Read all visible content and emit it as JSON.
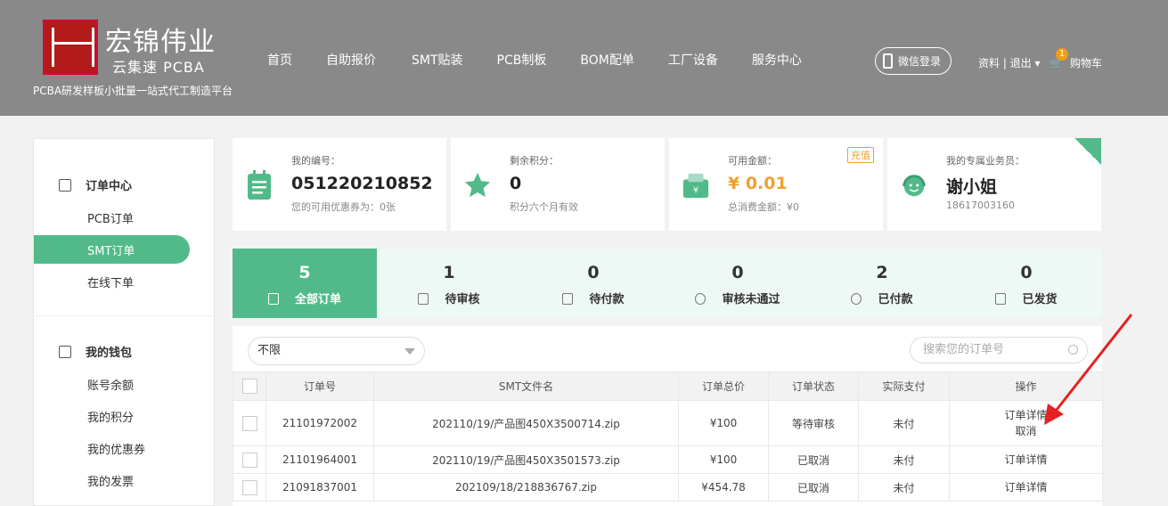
{
  "header": {
    "logo_title": "宏锦伟业",
    "logo_sub": "云集速 PCBA",
    "tagline": "PCBA研发样板小批量一站式代工制造平台",
    "nav": [
      "首页",
      "自助报价",
      "SMT贴装",
      "PCB制板",
      "BOM配单",
      "工厂设备",
      "服务中心"
    ],
    "wechat_login": "微信登录",
    "user_links": "资料 | 退出 ▾",
    "cart_label": "购物车",
    "cart_count": "1"
  },
  "sidebar": {
    "order_center": "订单中心",
    "order_items": [
      "PCB订单",
      "SMT订单",
      "在线下单"
    ],
    "active_item": "SMT订单",
    "wallet": "我的钱包",
    "wallet_items": [
      "账号余额",
      "我的积分",
      "我的优惠券",
      "我的发票"
    ]
  },
  "cards": {
    "id": {
      "label": "我的编号：",
      "value": "051220210852",
      "note": "您的可用优惠券为：0张"
    },
    "points": {
      "label": "剩余积分：",
      "value": "0",
      "note": "积分六个月有效"
    },
    "balance": {
      "label": "可用金额：",
      "value": "¥ 0.01",
      "note": "总消费金额：¥0",
      "badge": "充值"
    },
    "rep": {
      "label": "我的专属业务员：",
      "value": "谢小姐",
      "note": "18617003160"
    }
  },
  "tabs": [
    {
      "count": "5",
      "label": "全部订单"
    },
    {
      "count": "1",
      "label": "待审核"
    },
    {
      "count": "0",
      "label": "待付款"
    },
    {
      "count": "0",
      "label": "审核未通过"
    },
    {
      "count": "2",
      "label": "已付款"
    },
    {
      "count": "0",
      "label": "已发货"
    }
  ],
  "filter": {
    "value": "不限",
    "search_placeholder": "搜索您的订单号"
  },
  "table": {
    "headers": [
      "订单号",
      "SMT文件名",
      "订单总价",
      "订单状态",
      "实际支付",
      "操作"
    ],
    "rows": [
      {
        "id": "21101972002",
        "file": "202110/19/产品图450X3500714.zip",
        "price": "¥100",
        "status": "等待审核",
        "paid": "未付",
        "action1": "订单详情",
        "action2": "取消"
      },
      {
        "id": "21101964001",
        "file": "202110/19/产品图450X3501573.zip",
        "price": "¥100",
        "status": "已取消",
        "paid": "未付",
        "action1": "订单详情",
        "action2": ""
      },
      {
        "id": "21091837001",
        "file": "202109/18/218836767.zip",
        "price": "¥454.78",
        "status": "已取消",
        "paid": "未付",
        "action1": "订单详情",
        "action2": ""
      }
    ]
  },
  "colors": {
    "accent": "#52ba8a",
    "header_bg": "#898989",
    "danger": "#e02020",
    "gold": "#f0a030"
  }
}
